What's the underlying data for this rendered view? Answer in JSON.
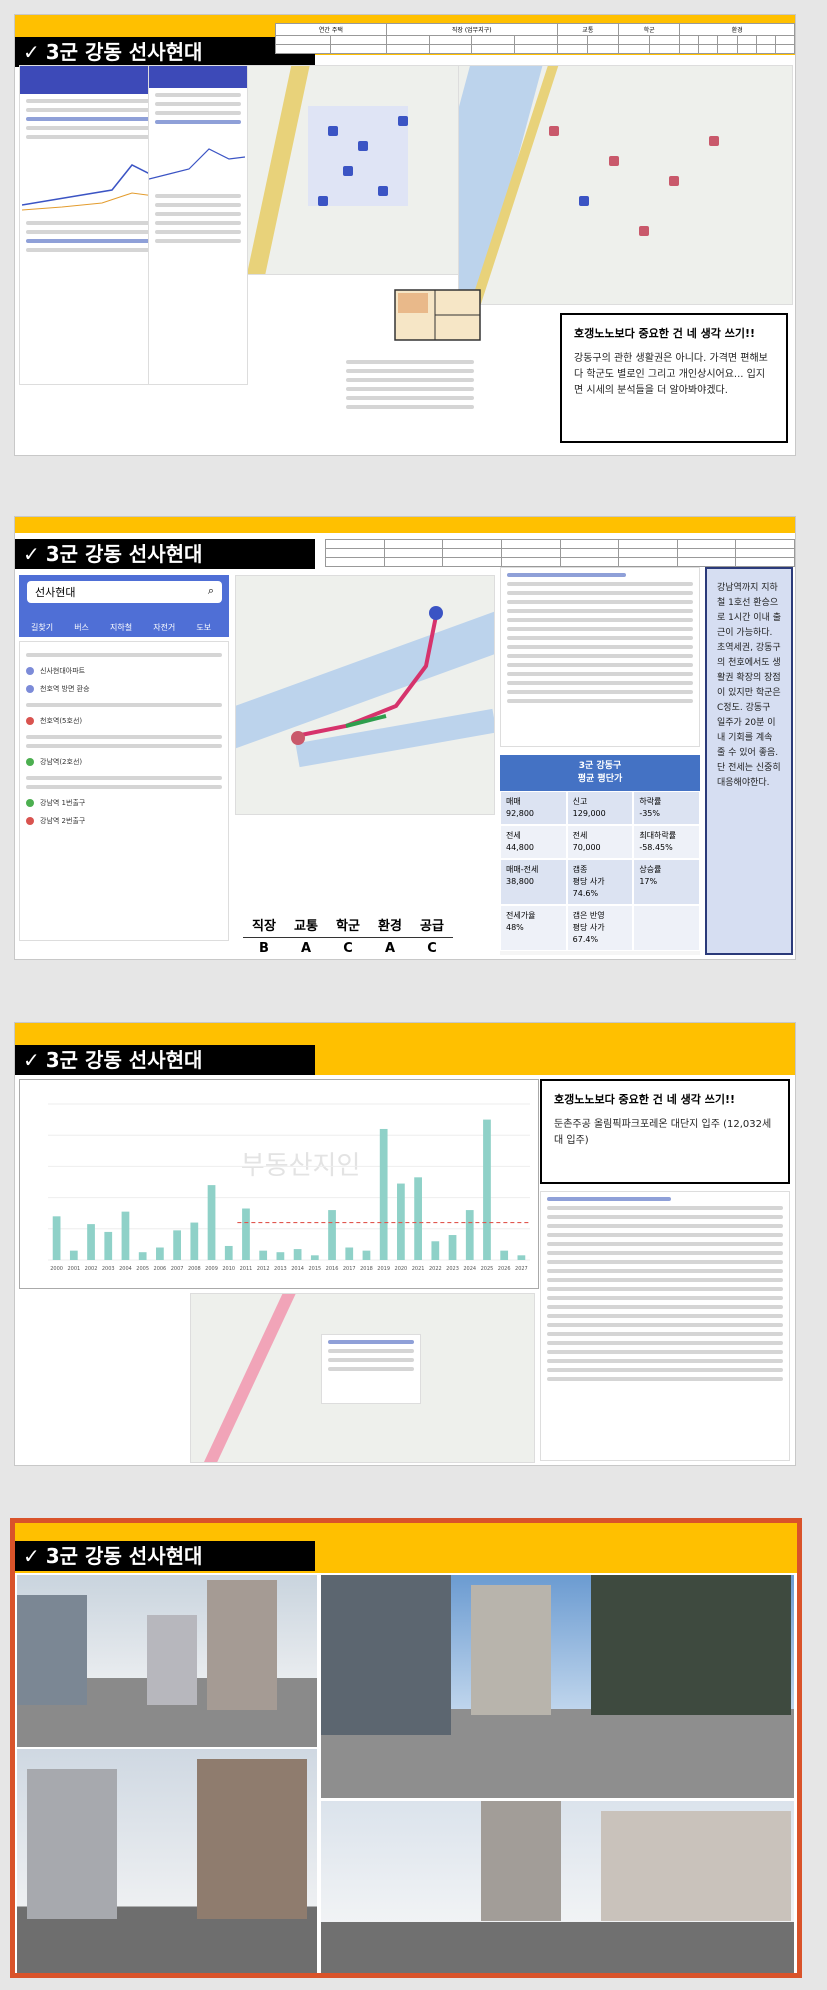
{
  "slides": [
    {
      "title": "3군 강동 선사현대",
      "table_headers": [
        "연간 주택",
        "직장 (업무지구)",
        "교통",
        "학군",
        "환경"
      ],
      "note": {
        "title": "호갱노노보다 중요한 건 네 생각 쓰기!!",
        "body": "강동구의 관한 생활권은 아니다. 가격면 편해보다 학군도 별로인 그리고 개인상시어요... 입지면 시세의 분석들을 더 알아봐야겠다."
      }
    },
    {
      "title": "3군 강동 선사현대",
      "search": {
        "value": "선사현대"
      },
      "nav_tabs": [
        "길찾기",
        "버스",
        "지하철",
        "자전거",
        "도보"
      ],
      "route_items": [
        "신사현대아파트",
        "천호역 방면 환승",
        "천호역(5호선)",
        "강남역(2호선)",
        "강남역 1번출구",
        "강남역 2번출구"
      ],
      "grades": {
        "headers": [
          "직장",
          "교통",
          "학군",
          "환경",
          "공급"
        ],
        "values": [
          "B",
          "A",
          "C",
          "A",
          "C"
        ]
      },
      "price_panel": {
        "heading": "3군 강동구\n평균 평단가",
        "cells": [
          "매매\n92,800",
          "신고\n129,000",
          "하락률\n-35%",
          "전세\n44,800",
          "전세\n70,000",
          "최대하락률\n-58.45%",
          "매매-전세\n38,800",
          "갭종\n평당 사가\n74.6%",
          "상승률\n17%",
          "전세가율\n48%",
          "갭은 반영\n평당 사가\n67.4%",
          ""
        ]
      },
      "explanation": "강남역까지 지하철 1호선 환승으로 1시간 이내 출근이 가능하다. 초역세권, 강동구의 천호에서도 생활권 확장의 장점이 있지만 학군은 C정도. 강동구 일주가 20분 이내 기회를 계속 줄 수 있어 좋음. 단 전세는 신중히 대응해야한다."
    },
    {
      "title": "3군 강동 선사현대",
      "note": {
        "title": "호갱노노보다 중요한 건 네 생각 쓰기!!",
        "body": "둔촌주공 올림픽파크포레온 대단지 입주 (12,032세대 입주)"
      },
      "watermark": "부동산지인",
      "chart_data": {
        "type": "bar",
        "title": "",
        "years": [
          "2000",
          "2001",
          "2002",
          "2003",
          "2004",
          "2005",
          "2006",
          "2007",
          "2008",
          "2009",
          "2010",
          "2011",
          "2012",
          "2013",
          "2014",
          "2015",
          "2016",
          "2017",
          "2018",
          "2019",
          "2020",
          "2021",
          "2022",
          "2023",
          "2024",
          "2025",
          "2026",
          "2027"
        ],
        "values": [
          2.8,
          0.6,
          2.3,
          1.8,
          3.1,
          0.5,
          0.8,
          1.9,
          2.4,
          4.8,
          0.9,
          3.3,
          0.6,
          0.5,
          0.7,
          0.3,
          3.2,
          0.8,
          0.6,
          8.4,
          4.9,
          5.3,
          1.2,
          1.6,
          3.2,
          9.0,
          0.6,
          0.3
        ],
        "demand_line": 2.4,
        "ylim": [
          0,
          10
        ],
        "xlabel": "",
        "ylabel": ""
      }
    },
    {
      "title": "3군 강동 선사현대"
    }
  ]
}
